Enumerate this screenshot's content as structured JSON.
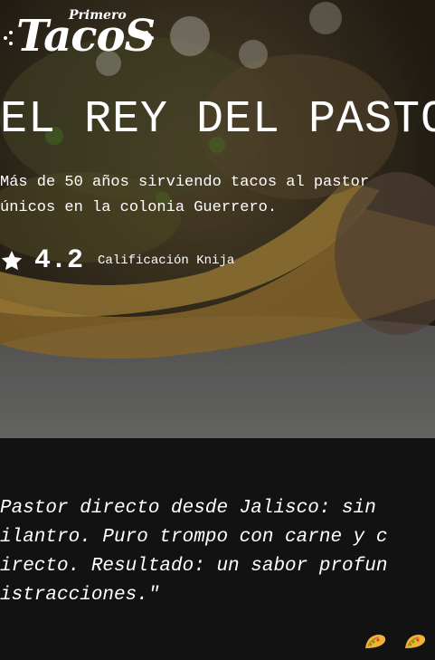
{
  "logo": {
    "small_text": "Primero",
    "main_text": "TacoS"
  },
  "hero": {
    "title": "EL REY DEL PASTOR",
    "subtitle_line1": "Más de 50 años sirviendo tacos al pastor",
    "subtitle_line2": "únicos en la colonia Guerrero.",
    "rating_icon": "star-icon",
    "rating_value": "4.2",
    "rating_label": "Calificación Knija"
  },
  "quote": {
    "text": "Pastor directo desde Jalisco: sin\nilantro. Puro trompo con carne y c\nirecto. Resultado: un sabor profun\nistracciones.\""
  },
  "footer_icons": [
    "taco-icon",
    "taco-icon"
  ],
  "colors": {
    "background_dark": "#121212",
    "text": "#ffffff",
    "taco_shell": "#f2b233"
  }
}
